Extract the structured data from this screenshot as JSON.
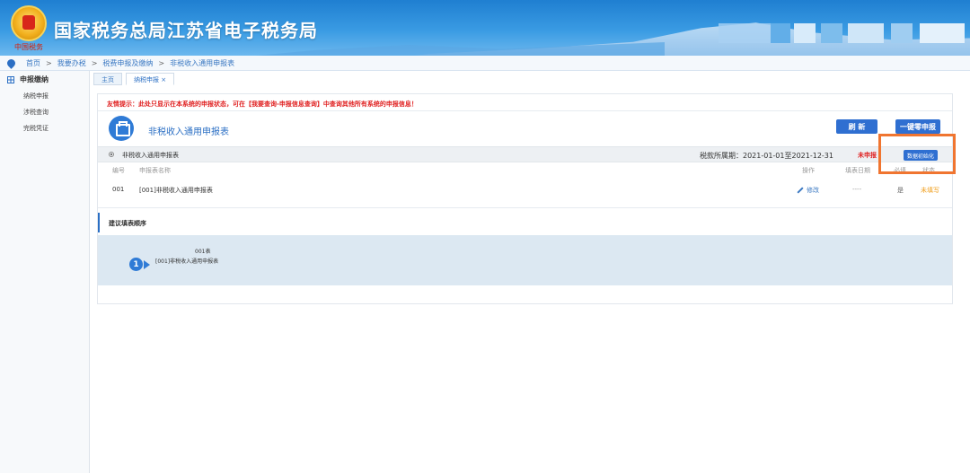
{
  "header": {
    "site_title": "国家税务总局江苏省电子税务局",
    "emblem_text": "中国税务"
  },
  "breadcrumb": {
    "items": [
      "首页",
      "我要办税",
      "税费申报及缴纳",
      "非税收入通用申报表"
    ],
    "separator": ">"
  },
  "sidebar": {
    "heading": "申报缴纳",
    "items": [
      "纳税申报",
      "涉税查询",
      "完税凭证"
    ]
  },
  "tabs": [
    {
      "label": "主页",
      "active": false
    },
    {
      "label": "纳税申报 ×",
      "active": true
    }
  ],
  "main": {
    "tip": "友情提示：此处只显示在本系统的申报状态，可在【我要查询-申报信息查询】中查询其他所有系统的申报信息！",
    "form_title": "非税收入通用申报表",
    "refresh_label": "刷 新",
    "zero_declare_label": "一键零申报",
    "row": {
      "name": "非税收入通用申报表",
      "period": "税款所属期：2021-01-01至2021-12-31",
      "status": "未申报",
      "init_label": "数据初始化"
    },
    "columns": {
      "no": "编号",
      "name": "申报表名称",
      "action": "操作",
      "fill_date": "填表日期",
      "required": "必填",
      "state": "状态"
    },
    "records": [
      {
        "no": "001",
        "name": "[001]非税收入通用申报表",
        "action": "修改",
        "fill_date": "----",
        "required": "是",
        "state": "未填写"
      }
    ],
    "suggest_title": "建议填表顺序",
    "steps": [
      {
        "number": "1",
        "code": "001表",
        "name": "[001]非税收入通用申报表"
      }
    ]
  },
  "colors": {
    "accent": "#2f6fd1",
    "warning": "#e02020",
    "highlight": "#f07530",
    "unfilled": "#f0a020"
  }
}
